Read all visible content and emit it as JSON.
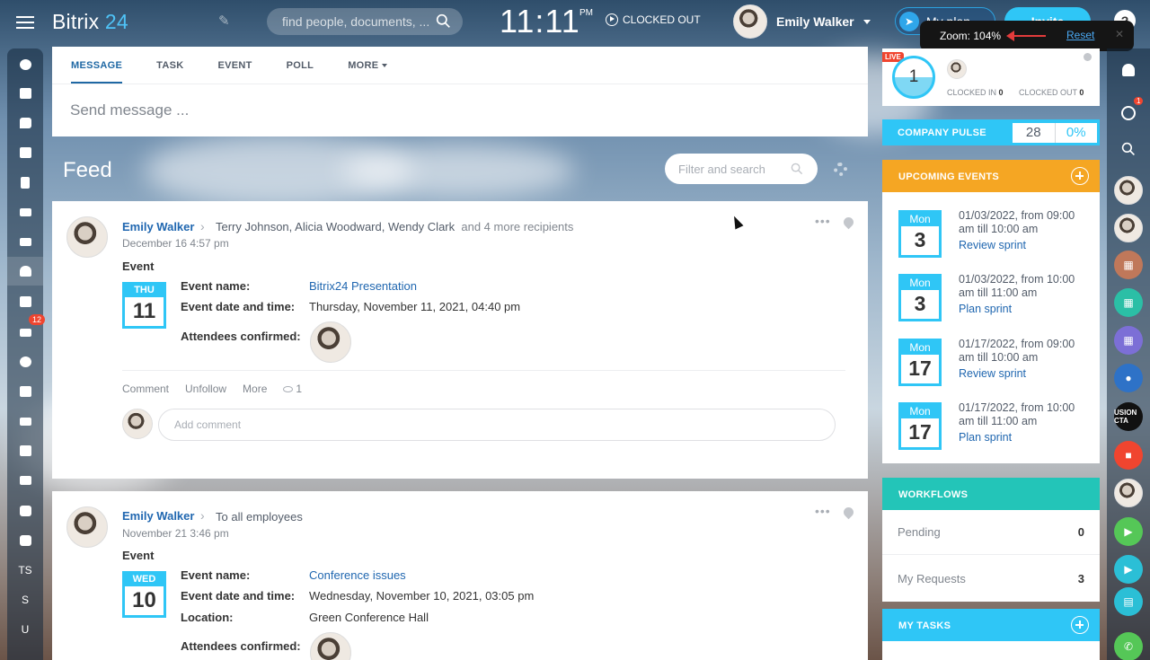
{
  "app": {
    "logo": "Bitrix",
    "logo_num": "24",
    "search_placeholder": "find people, documents, ...",
    "time": "11:11",
    "ampm": "PM",
    "clock_status": "CLOCKED OUT",
    "user_name": "Emily Walker",
    "my_plan": "My plan",
    "invite": "Invite",
    "help": "?"
  },
  "zoom": {
    "label": "Zoom: 104%",
    "reset": "Reset",
    "close": "✕"
  },
  "left_nav": {
    "badge": "12",
    "texts": [
      "TS",
      "S",
      "U"
    ]
  },
  "composer": {
    "tabs": [
      "MESSAGE",
      "TASK",
      "EVENT",
      "POLL",
      "MORE"
    ],
    "placeholder": "Send message ..."
  },
  "feed": {
    "title": "Feed",
    "filter_placeholder": "Filter and search"
  },
  "posts": [
    {
      "author": "Emily Walker",
      "recipients": "Terry Johnson, Alicia Woodward, Wendy Clark",
      "more_recipients": "and 4 more recipients",
      "date": "December 16 4:57 pm",
      "type": "Event",
      "cal_dow": "THU",
      "cal_day": "11",
      "labels": [
        "Event name:",
        "Event date and time:",
        "Attendees confirmed:"
      ],
      "event_name": "Bitrix24 Presentation",
      "event_datetime": "Thursday, November 11, 2021, 04:40 pm",
      "actions": [
        "Comment",
        "Unfollow",
        "More"
      ],
      "views": "1",
      "comment_placeholder": "Add comment"
    },
    {
      "author": "Emily Walker",
      "recipients": "To all employees",
      "date": "November 21 3:46 pm",
      "type": "Event",
      "cal_dow": "WED",
      "cal_day": "10",
      "labels": [
        "Event name:",
        "Event date and time:",
        "Location:",
        "Attendees confirmed:"
      ],
      "event_name": "Conference issues",
      "event_datetime": "Wednesday, November 10, 2021, 03:05 pm",
      "location": "Green Conference Hall"
    }
  ],
  "timeman": {
    "live": "LIVE",
    "count": "1",
    "clocked_in_label": "CLOCKED IN",
    "clocked_in": "0",
    "clocked_out_label": "CLOCKED OUT",
    "clocked_out": "0"
  },
  "pulse": {
    "label": "COMPANY PULSE",
    "value": "28",
    "percent": "0%"
  },
  "events": {
    "title": "UPCOMING EVENTS",
    "items": [
      {
        "dow": "Mon",
        "day": "3",
        "when": "01/03/2022, from 09:00 am till 10:00 am",
        "title": "Review sprint"
      },
      {
        "dow": "Mon",
        "day": "3",
        "when": "01/03/2022, from 10:00 am till 11:00 am",
        "title": "Plan sprint"
      },
      {
        "dow": "Mon",
        "day": "17",
        "when": "01/17/2022, from 09:00 am till 10:00 am",
        "title": "Review sprint"
      },
      {
        "dow": "Mon",
        "day": "17",
        "when": "01/17/2022, from 10:00 am till 11:00 am",
        "title": "Plan sprint"
      }
    ]
  },
  "workflows": {
    "title": "WORKFLOWS",
    "rows": [
      {
        "label": "Pending",
        "value": "0"
      },
      {
        "label": "My Requests",
        "value": "3"
      }
    ]
  },
  "tasks": {
    "title": "MY TASKS"
  },
  "rail": {
    "badge": "1",
    "text_item": "USION CTA"
  },
  "colors": {
    "accent": "#2fc6f6",
    "events_header": "#f5a623",
    "workflows_header": "#23c5b8",
    "link": "#2067b0",
    "badge": "#f0452f"
  }
}
